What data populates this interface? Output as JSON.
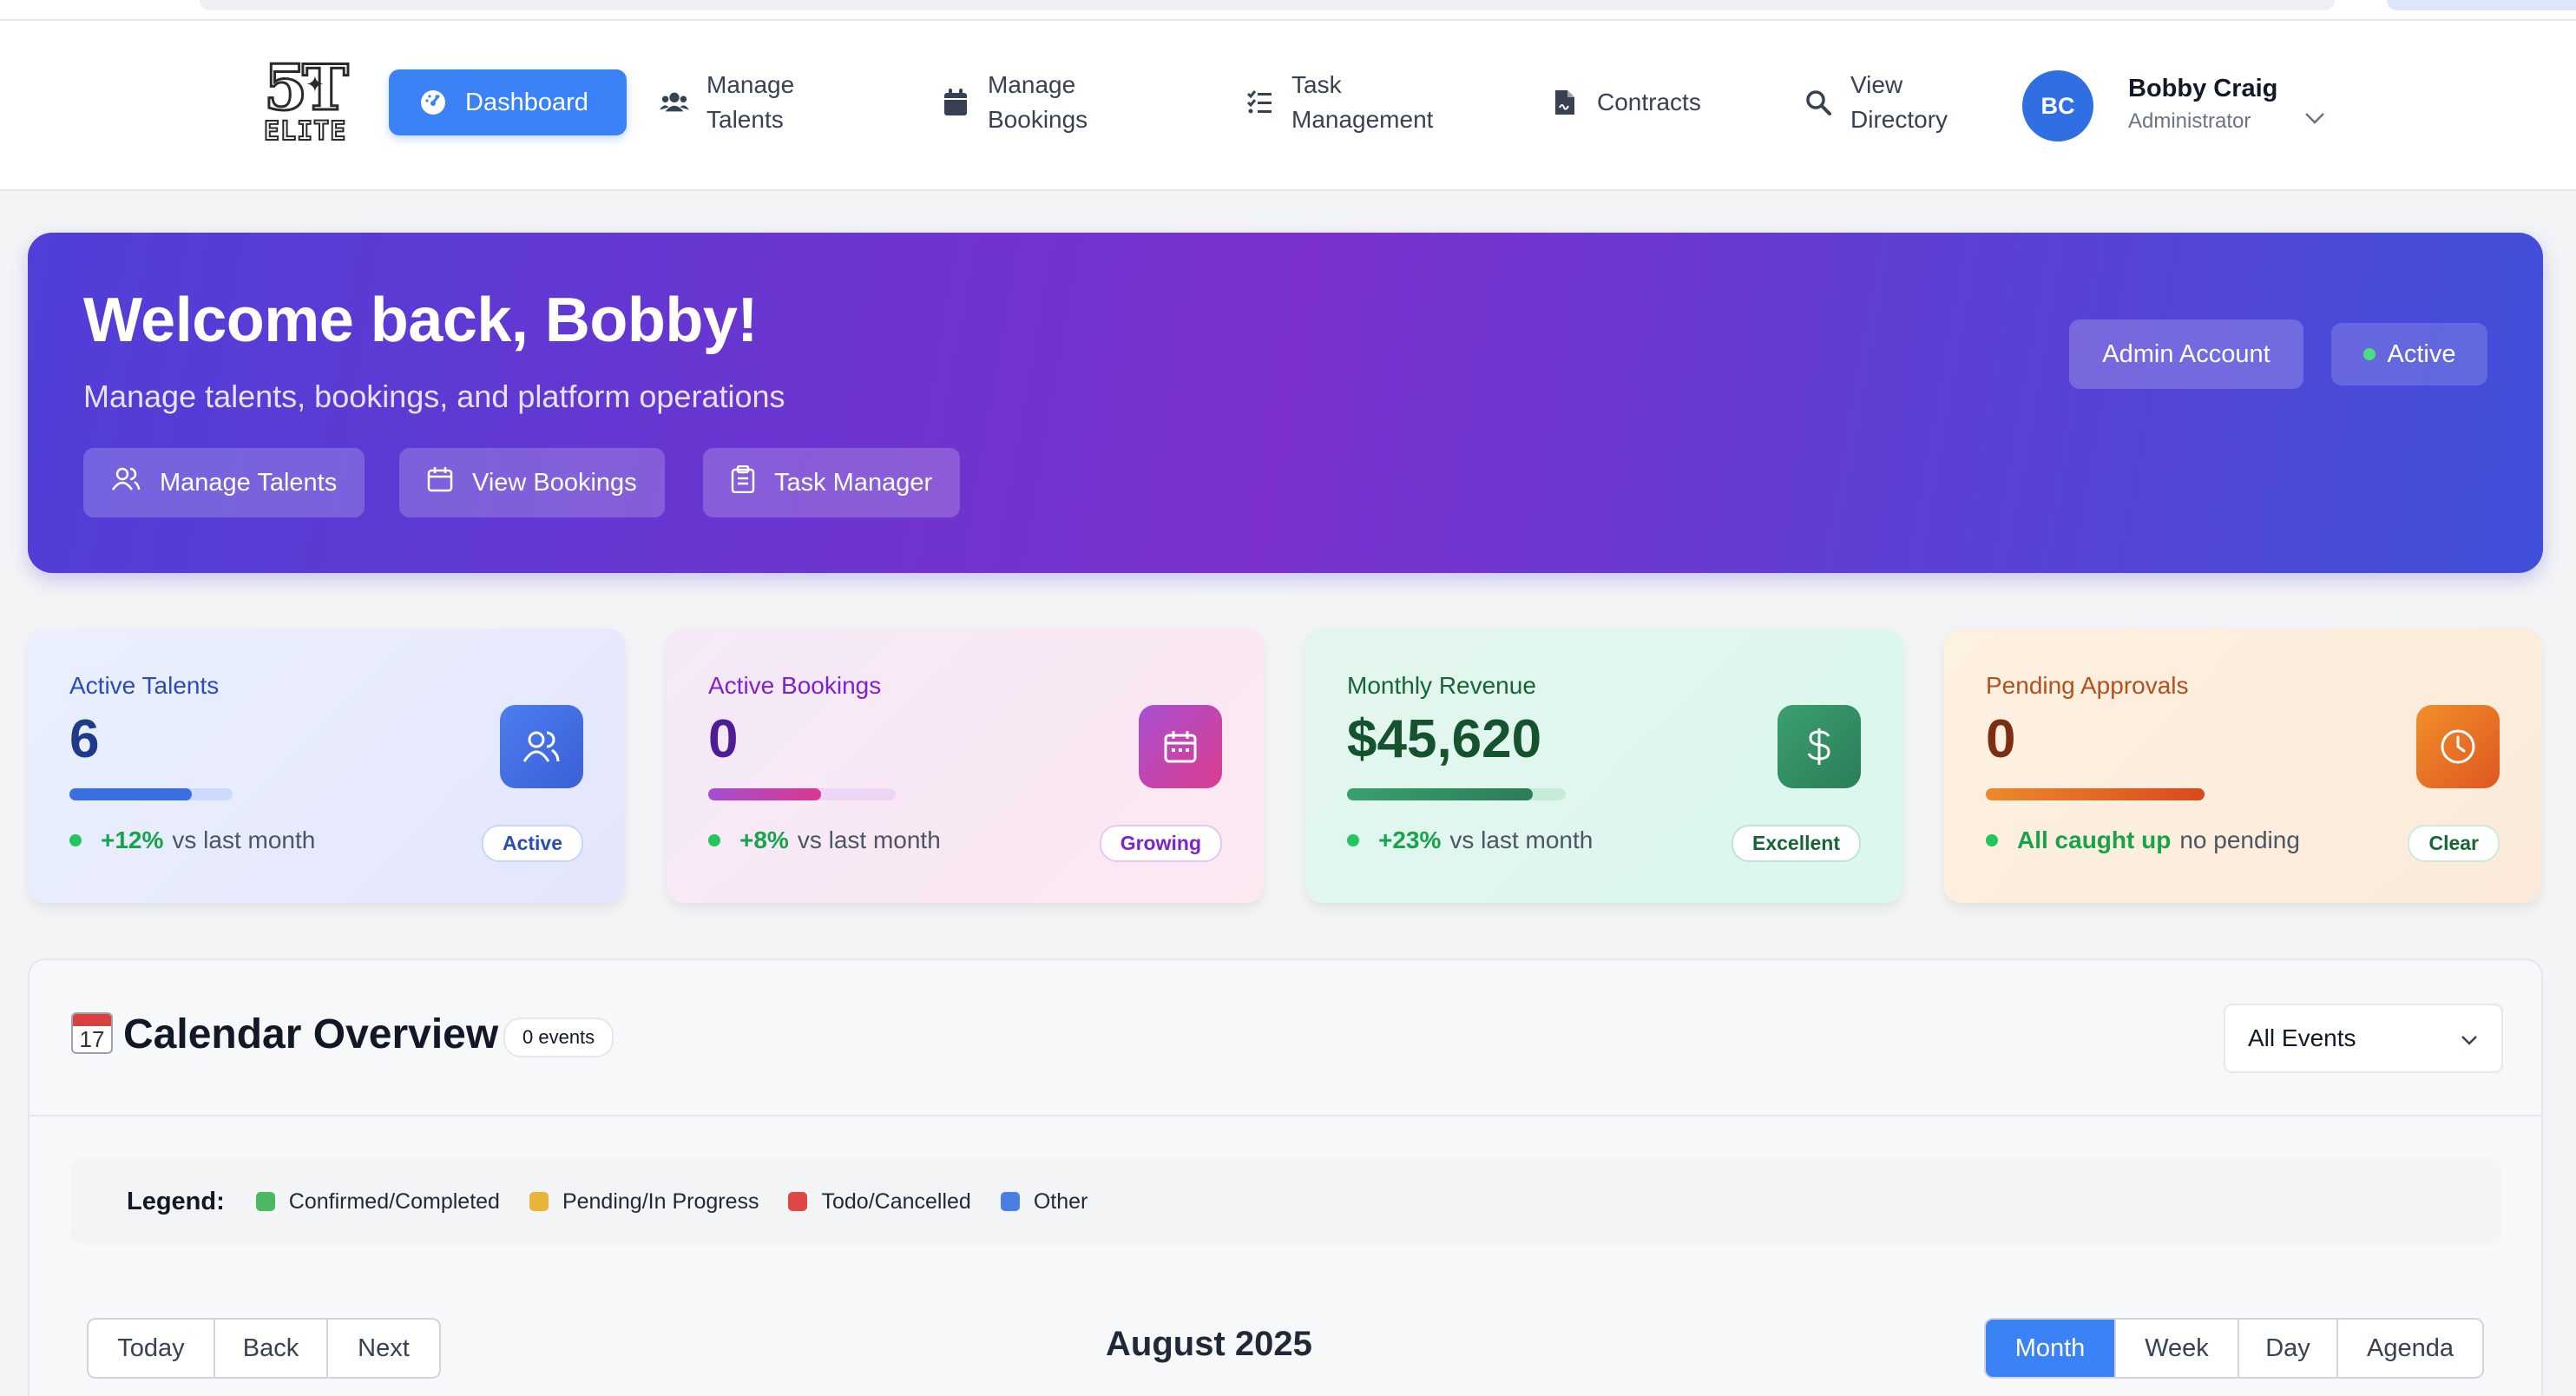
{
  "brand": {
    "logo_top": "5T",
    "logo_bottom": "ELITE"
  },
  "nav": {
    "items": [
      {
        "label": "Dashboard",
        "icon": "gauge-icon",
        "active": true
      },
      {
        "label": "Manage Talents",
        "icon": "users-icon"
      },
      {
        "label": "Manage Bookings",
        "icon": "calendar-icon"
      },
      {
        "label": "Task Management",
        "icon": "tasks-icon"
      },
      {
        "label": "Contracts",
        "icon": "file-contract-icon"
      },
      {
        "label": "View Directory",
        "icon": "search-icon"
      }
    ]
  },
  "user": {
    "initials": "BC",
    "name": "Bobby Craig",
    "role": "Administrator"
  },
  "hero": {
    "title": "Welcome back, Bobby!",
    "subtitle": "Manage talents, bookings, and platform operations",
    "buttons": [
      "Manage Talents",
      "View Bookings",
      "Task Manager"
    ],
    "account_label": "Admin Account",
    "status_label": "Active"
  },
  "stats": [
    {
      "title": "Active Talents",
      "value": "6",
      "change": "+12%",
      "change_text": "vs last month",
      "badge": "Active",
      "progress": 0.75,
      "color": "#3b6fe0"
    },
    {
      "title": "Active Bookings",
      "value": "0",
      "change": "+8%",
      "change_text": "vs last month",
      "badge": "Growing",
      "progress": 0.6,
      "color": "#b03fb5"
    },
    {
      "title": "Monthly Revenue",
      "value": "$45,620",
      "change": "+23%",
      "change_text": "vs last month",
      "badge": "Excellent",
      "progress": 0.85,
      "color": "#2f8a63"
    },
    {
      "title": "Pending Approvals",
      "value": "0",
      "change": "All caught up",
      "change_text": "no pending",
      "badge": "Clear",
      "progress": 1.0,
      "color": "#d9601e"
    }
  ],
  "calendar": {
    "emoji_day": "17",
    "title": "Calendar Overview",
    "event_count": "0 events",
    "filter": "All Events",
    "legend_label": "Legend:",
    "legend": [
      {
        "label": "Confirmed/Completed",
        "color": "#4cb862"
      },
      {
        "label": "Pending/In Progress",
        "color": "#e8b53a"
      },
      {
        "label": "Todo/Cancelled",
        "color": "#e04848"
      },
      {
        "label": "Other",
        "color": "#4c7ee8"
      }
    ],
    "nav_buttons": [
      "Today",
      "Back",
      "Next"
    ],
    "month": "August 2025",
    "views": [
      "Month",
      "Week",
      "Day",
      "Agenda"
    ],
    "selected_view": "Month"
  }
}
